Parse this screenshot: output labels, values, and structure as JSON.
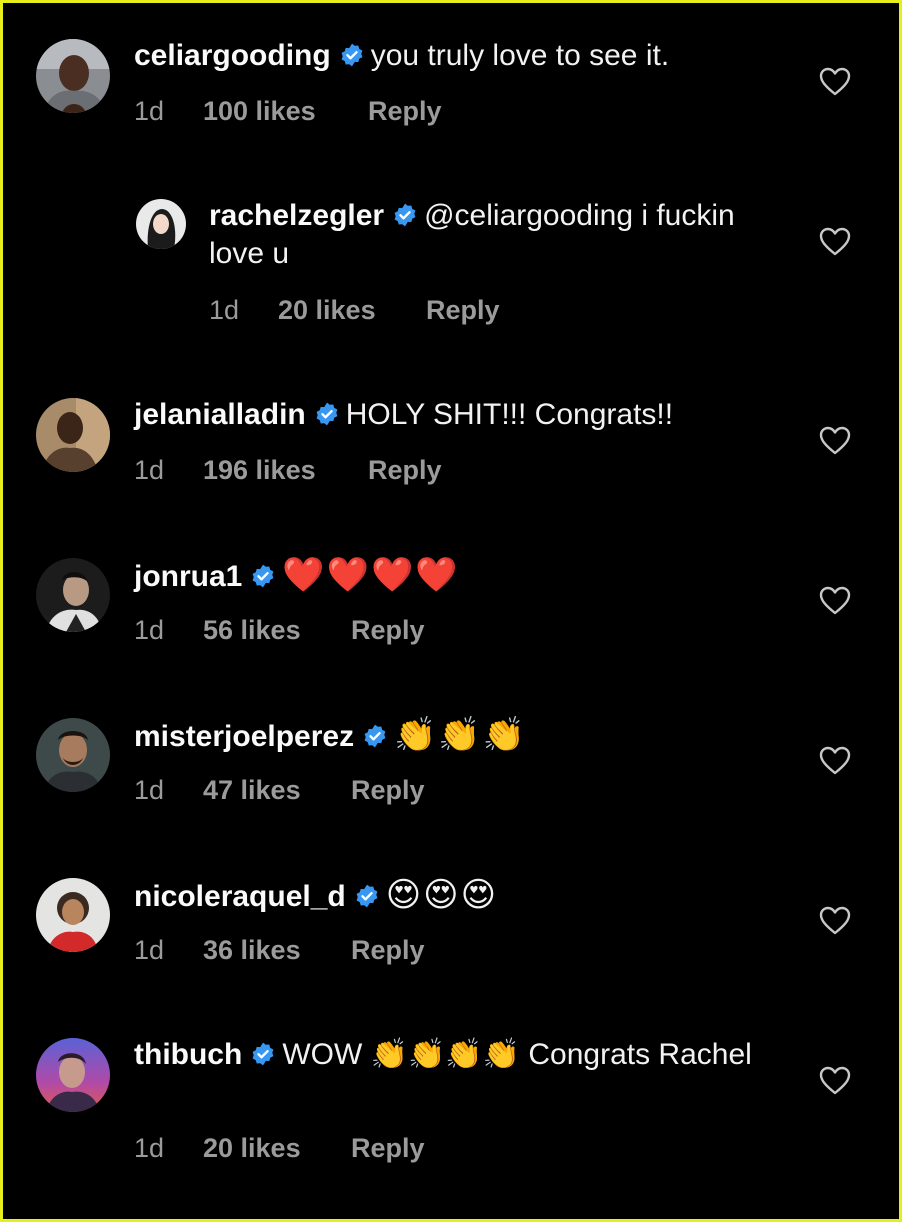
{
  "comments": [
    {
      "username": "celiargooding",
      "text": "you truly love to see it.",
      "time": "1d",
      "likes": "100 likes",
      "reply_label": "Reply",
      "avatar_icon": "avatar-celiargooding",
      "heart_icon": "heart-outline-icon"
    },
    {
      "username": "rachelzegler",
      "text": "@celiargooding i fuckin love u",
      "time": "1d",
      "likes": "20 likes",
      "reply_label": "Reply",
      "is_reply": true,
      "avatar_icon": "avatar-rachelzegler",
      "heart_icon": "heart-outline-icon"
    },
    {
      "username": "jelanialladin",
      "text": "HOLY SHIT!!! Congrats!!",
      "time": "1d",
      "likes": "196 likes",
      "reply_label": "Reply",
      "avatar_icon": "avatar-jelanialladin",
      "heart_icon": "heart-outline-icon"
    },
    {
      "username": "jonrua1",
      "text": "❤️❤️❤️❤️",
      "time": "1d",
      "likes": "56 likes",
      "reply_label": "Reply",
      "avatar_icon": "avatar-jonrua1",
      "heart_icon": "heart-outline-icon"
    },
    {
      "username": "misterjoelperez",
      "text": "👏👏👏",
      "time": "1d",
      "likes": "47 likes",
      "reply_label": "Reply",
      "avatar_icon": "avatar-misterjoelperez",
      "heart_icon": "heart-outline-icon"
    },
    {
      "username": "nicoleraquel_d",
      "text": "😍😍😍",
      "time": "1d",
      "likes": "36 likes",
      "reply_label": "Reply",
      "avatar_icon": "avatar-nicoleraquel_d",
      "heart_icon": "heart-outline-icon"
    },
    {
      "username": "thibuch",
      "text": "WOW 👏👏👏👏 Congrats Rachel",
      "time": "1d",
      "likes": "20 likes",
      "reply_label": "Reply",
      "avatar_icon": "avatar-thibuch",
      "heart_icon": "heart-outline-icon"
    }
  ],
  "colors": {
    "background": "#000000",
    "frame_border": "#e6ee1c",
    "verified_badge": "#3897f0",
    "meta_text": "#9b9b9b"
  },
  "verified_icon": "verified-badge-icon"
}
